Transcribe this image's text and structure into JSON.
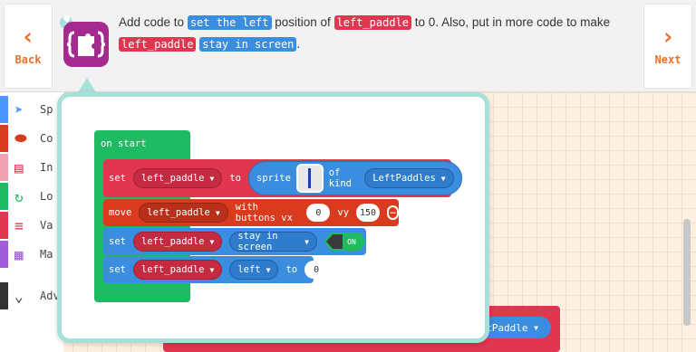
{
  "nav": {
    "back_label": "Back",
    "next_label": "Next"
  },
  "hint": {
    "t1": "Add code to ",
    "tok1": "set the left",
    "t2": " position of ",
    "tok2": "left_paddle",
    "t3": " to 0. Also, put in more code to make ",
    "tok3": "left_paddle",
    "t4": " ",
    "tok4": "stay in screen",
    "t5": "."
  },
  "toolbox": {
    "items": [
      {
        "label": "Sp",
        "color": "#4c97ff",
        "icon": "paper-plane-icon"
      },
      {
        "label": "Co",
        "color": "#d93b1f",
        "icon": "gamepad-icon"
      },
      {
        "label": "In",
        "color": "#f0a2b0",
        "icon": "id-card-icon"
      },
      {
        "label": "Lo",
        "color": "#1fbb62",
        "icon": "loop-icon"
      },
      {
        "label": "Va",
        "color": "#e0364f",
        "icon": "list-icon"
      },
      {
        "label": "Ma",
        "color": "#a15cd9",
        "icon": "calculator-icon"
      },
      {
        "label": "Adv",
        "color": "#333333",
        "icon": "chevron-down-icon"
      }
    ]
  },
  "blocks": {
    "on_start": "on start",
    "row1": {
      "set": "set",
      "var": "left_paddle",
      "to": "to",
      "sprite": "sprite",
      "of_kind": "of kind",
      "kind": "LeftPaddles"
    },
    "row2": {
      "move": "move",
      "var": "left_paddle",
      "with_buttons": "with buttons vx",
      "vx": "0",
      "vy_label": "vy",
      "vy": "150"
    },
    "row3": {
      "set": "set",
      "var": "left_paddle",
      "flag": "stay in screen",
      "toggle": "ON"
    },
    "row4": {
      "set": "set",
      "var": "left_paddle",
      "prop": "left",
      "to": "to",
      "value": "0"
    },
    "bg_kind": "ftPaddle"
  }
}
